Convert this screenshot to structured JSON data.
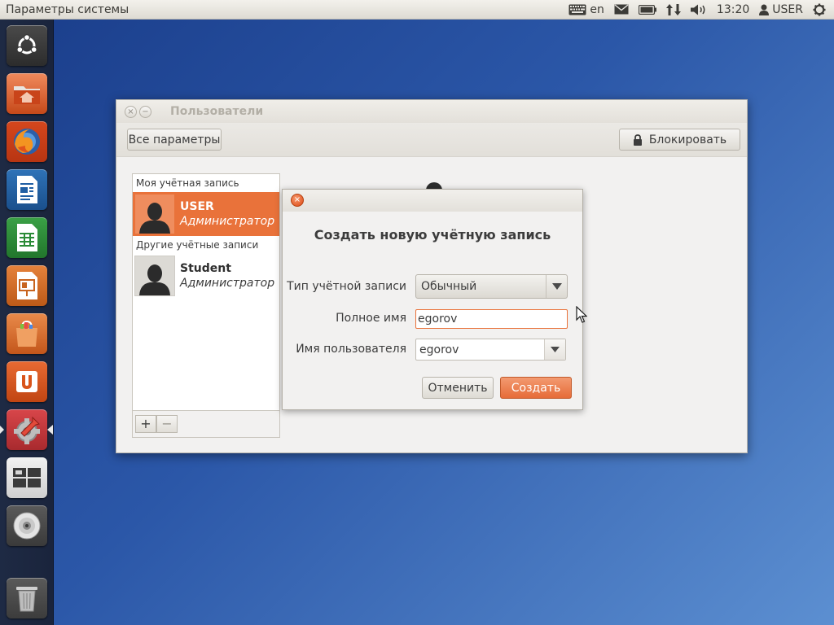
{
  "top_panel": {
    "title": "Параметры системы",
    "keyboard_layout": "en",
    "clock": "13:20",
    "user": "USER"
  },
  "launcher": {
    "items": [
      "dash-home",
      "files",
      "firefox",
      "writer",
      "calc",
      "impress",
      "software-center",
      "ubuntu-one",
      "system-settings",
      "workspaces",
      "dvd",
      "trash"
    ]
  },
  "window": {
    "title": "Пользователи",
    "all_settings_label": "Все параметры",
    "lock_label": "Блокировать",
    "my_account_label": "Моя учётная запись",
    "other_accounts_label": "Другие учётные записи",
    "accounts": [
      {
        "name": "USER",
        "role": "Администратор"
      },
      {
        "name": "Student",
        "role": "Администратор"
      }
    ],
    "add_label": "+",
    "remove_label": "−"
  },
  "dialog": {
    "heading": "Создать новую учётную запись",
    "account_type_label": "Тип учётной записи",
    "account_type_value": "Обычный",
    "full_name_label": "Полное имя",
    "full_name_value": "egorov",
    "username_label": "Имя пользователя",
    "username_value": "egorov",
    "cancel_label": "Отменить",
    "create_label": "Создать"
  },
  "colors": {
    "accent": "#e9723a",
    "launcher_bg": "#1e2a44",
    "desktop": "#2b57a8"
  }
}
